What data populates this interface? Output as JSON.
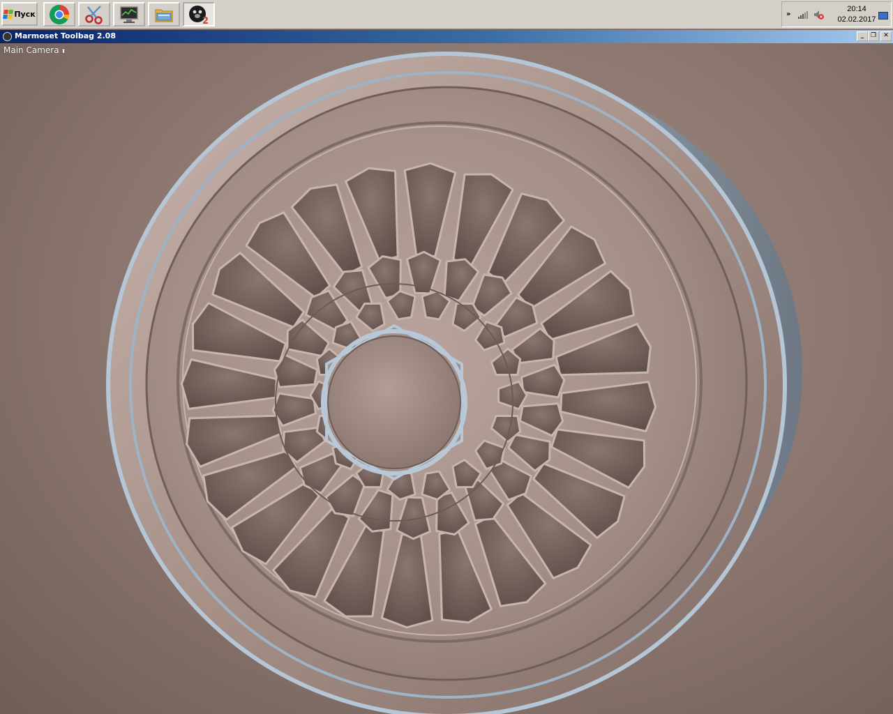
{
  "taskbar": {
    "start_label": "Пуск",
    "apps": [
      {
        "name": "Google Chrome",
        "icon": "chrome-icon"
      },
      {
        "name": "Snipping Tool",
        "icon": "scissors-icon"
      },
      {
        "name": "Task Manager",
        "icon": "monitor-icon"
      },
      {
        "name": "Explorer",
        "icon": "folder-icon"
      },
      {
        "name": "Marmoset Toolbag 2",
        "icon": "marmoset-icon"
      }
    ],
    "clock": {
      "time": "20:14",
      "date": "02.02.2017"
    }
  },
  "window": {
    "title": "Marmoset Toolbag 2.08",
    "controls": {
      "minimize": "_",
      "restore": "❐",
      "close": "✕"
    }
  },
  "viewport": {
    "camera_label": "Main Camera"
  }
}
